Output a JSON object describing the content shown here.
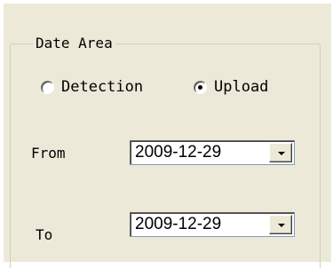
{
  "group": {
    "title": "Date Area"
  },
  "radios": [
    {
      "label": "Detection",
      "selected": false
    },
    {
      "label": "Upload",
      "selected": true
    }
  ],
  "from": {
    "label": "From",
    "value": "2009-12-29",
    "dropdown_icon": "chevron-down-icon"
  },
  "to": {
    "label": "To",
    "value": "2009-12-29",
    "dropdown_icon": "chevron-down-icon"
  }
}
